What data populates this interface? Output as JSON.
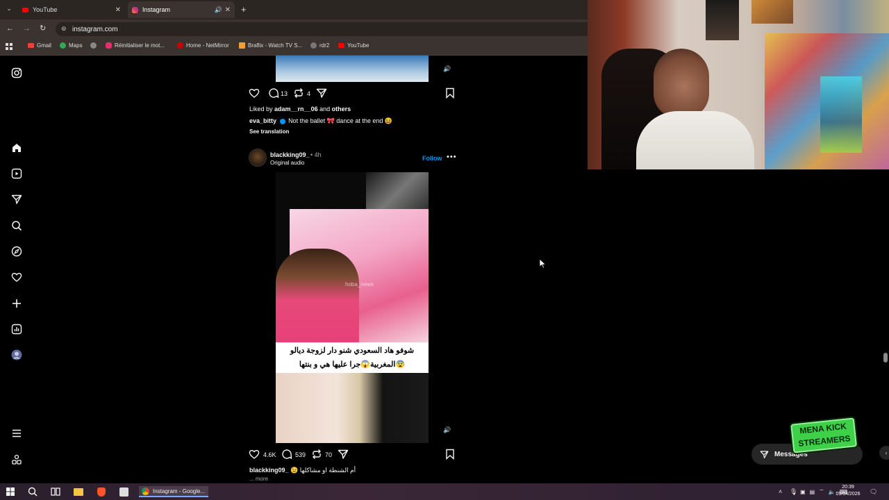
{
  "browser": {
    "tabs": [
      {
        "title": "YouTube",
        "active": false
      },
      {
        "title": "Instagram",
        "active": true
      }
    ],
    "url": "instagram.com",
    "bookmarks": [
      "Gmail",
      "Maps",
      "Réinitialiser le mot...",
      "Home - NetMirror",
      "Braflix - Watch TV S...",
      "rdr2",
      "YouTube"
    ]
  },
  "sidebar": {
    "icons": [
      "instagram-logo-icon",
      "home-icon",
      "reels-icon",
      "direct-icon",
      "search-icon",
      "explore-icon",
      "notifications-icon",
      "create-icon",
      "dashboard-icon",
      "profile-icon",
      "more-menu-icon",
      "threads-icon"
    ]
  },
  "post1": {
    "comments": "13",
    "reposts": "4",
    "liked_by_prefix": "Liked by ",
    "liked_by_user": "adam__rn__06",
    "liked_by_and": " and ",
    "liked_by_others": "others",
    "caption_user": "eva_bitty",
    "caption_text": "Not the ballet 🎀 dance at the end 😆",
    "see_translation": "See translation"
  },
  "post2": {
    "username": "blackking09_",
    "time": "• 4h",
    "audio": "Original audio",
    "follow": "Follow",
    "overlay_line1": "شوفو هاد السعودي شنو دار لزوجة ديالو",
    "overlay_line2": "المغربية😱جرا عليها هي و بنتها😨",
    "watermark": "hoba_news",
    "likes": "4.6K",
    "comments": "539",
    "reposts": "70",
    "caption_user": "blackking09_",
    "caption_text": "😉 أم الشنطة او مشاكلها",
    "more": "... more"
  },
  "messages": {
    "label": "Messages"
  },
  "taskbar": {
    "active_app": "Instagram - Google...",
    "time": "20:39",
    "date": "09/04/2026"
  },
  "overlay_logo": {
    "line1": "MENA KICK",
    "line2": "STREAMERS"
  },
  "colors": {
    "follow": "#0095f6",
    "background": "#000000",
    "verified": "#0095f6"
  }
}
